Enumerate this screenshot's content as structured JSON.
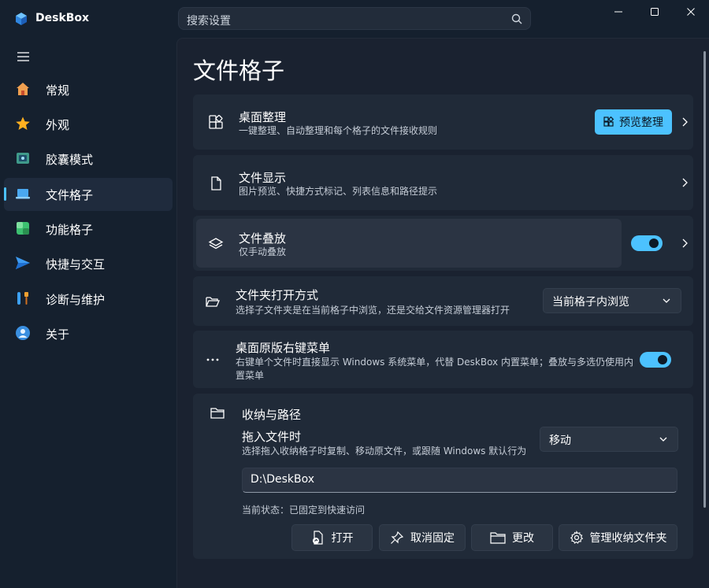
{
  "app": {
    "title": "DeskBox",
    "logo_icon": "cube-logo-icon"
  },
  "search": {
    "placeholder": "搜索设置",
    "icon": "search-icon"
  },
  "window_controls": [
    "minimize",
    "maximize",
    "close"
  ],
  "sidebar": {
    "items": [
      {
        "label": "常规",
        "icon": "home-icon"
      },
      {
        "label": "外观",
        "icon": "star-icon"
      },
      {
        "label": "胶囊模式",
        "icon": "capsule-icon"
      },
      {
        "label": "文件格子",
        "icon": "laptop-icon",
        "active": true
      },
      {
        "label": "功能格子",
        "icon": "grid-icon"
      },
      {
        "label": "快捷与交互",
        "icon": "send-icon"
      },
      {
        "label": "诊断与维护",
        "icon": "tools-icon"
      },
      {
        "label": "关于",
        "icon": "info-avatar-icon"
      }
    ]
  },
  "page": {
    "title": "文件格子"
  },
  "cards": {
    "organize": {
      "title": "桌面整理",
      "desc": "一键整理、自动整理和每个格子的文件接收规则",
      "button": "预览整理"
    },
    "display": {
      "title": "文件显示",
      "desc": "图片预览、快捷方式标记、列表信息和路径提示"
    },
    "stack": {
      "title": "文件叠放",
      "desc": "仅手动叠放",
      "toggle_on": true
    },
    "folder_open": {
      "title": "文件夹打开方式",
      "desc": "选择子文件夹是在当前格子中浏览，还是交给文件资源管理器打开",
      "value": "当前格子内浏览"
    },
    "context_menu": {
      "title": "桌面原版右键菜单",
      "desc": "右键单个文件时直接显示 Windows 系统菜单，代替 DeskBox 内置菜单；叠放与多选仍使用内置菜单",
      "toggle_on": true
    },
    "storage": {
      "title": "收纳与路径",
      "drop_title": "拖入文件时",
      "drop_desc": "选择拖入收纳格子时复制、移动原文件，或跟随 Windows 默认行为",
      "drop_value": "移动",
      "path": "D:\\DeskBox",
      "status": "当前状态：已固定到快速访问",
      "actions": {
        "open": "打开",
        "unpin": "取消固定",
        "change": "更改",
        "manage": "管理收纳文件夹"
      }
    }
  },
  "colors": {
    "accent": "#4cc2ff",
    "background": "#15202e",
    "card": "#202a38"
  }
}
